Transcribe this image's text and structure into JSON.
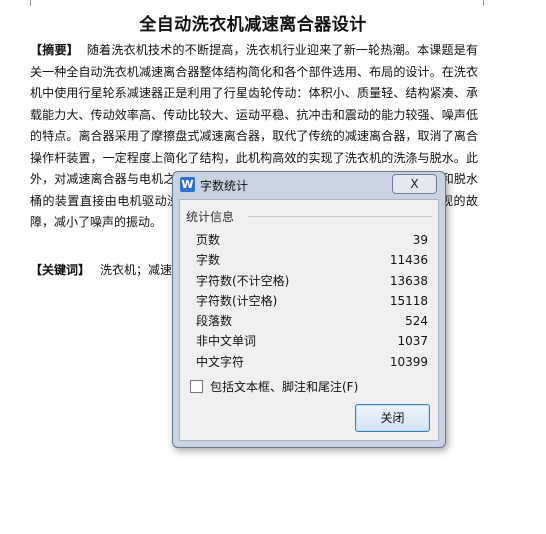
{
  "document": {
    "title": "全自动洗衣机减速离合器设计",
    "abstract_label": "【摘要】",
    "abstract_text": "随着洗衣机技术的不断提高，洗衣机行业迎来了新一轮热潮。本课题是有关一种全自动洗衣机减速离合器整体结构简化和各个部件选用、布局的设计。在洗衣机中使用行星轮系减速器正是利用了行星齿轮传动：体积小、质量轻、结构紧凑、承载能力大、传动效率高、传动比较大、运动平稳、抗冲击和震动的能力较强、噪声低的特点。离合器采用了摩擦盘式减速离合器，取代了传统的减速离合器，取消了离合操作杆装置，一定程度上简化了结构，此机构高效的实现了洗衣机的洗涤与脱水。此外，对减速离合器与电机之间的连接方式进行了改进，由电机驱动洗衣机波轮和脱水桶的装置直接由电机驱动洗衣机波轮和脱水桶，避免了传统皮带传动容易出现的故障，减小了噪声的振动。",
    "keywords_label": "【关键词】",
    "keywords_text": "洗衣机；减速离合器"
  },
  "dialog": {
    "title": "字数统计",
    "app_icon_letter": "W",
    "titlebar_close": "X",
    "group_title": "统计信息",
    "stats": [
      {
        "label": "页数",
        "value": "39"
      },
      {
        "label": "字数",
        "value": "11436"
      },
      {
        "label": "字符数(不计空格)",
        "value": "13638"
      },
      {
        "label": "字符数(计空格)",
        "value": "15118"
      },
      {
        "label": "段落数",
        "value": "524"
      },
      {
        "label": "非中文单词",
        "value": "1037"
      },
      {
        "label": "中文字符",
        "value": "10399"
      }
    ],
    "checkbox_label": "包括文本框、脚注和尾注(F)",
    "checkbox_checked": false,
    "close_button": "关闭"
  },
  "colors": {
    "dialog_frame": "#c9d3e1",
    "dialog_client": "#f0f0f0",
    "app_icon": "#2f6fd1"
  }
}
